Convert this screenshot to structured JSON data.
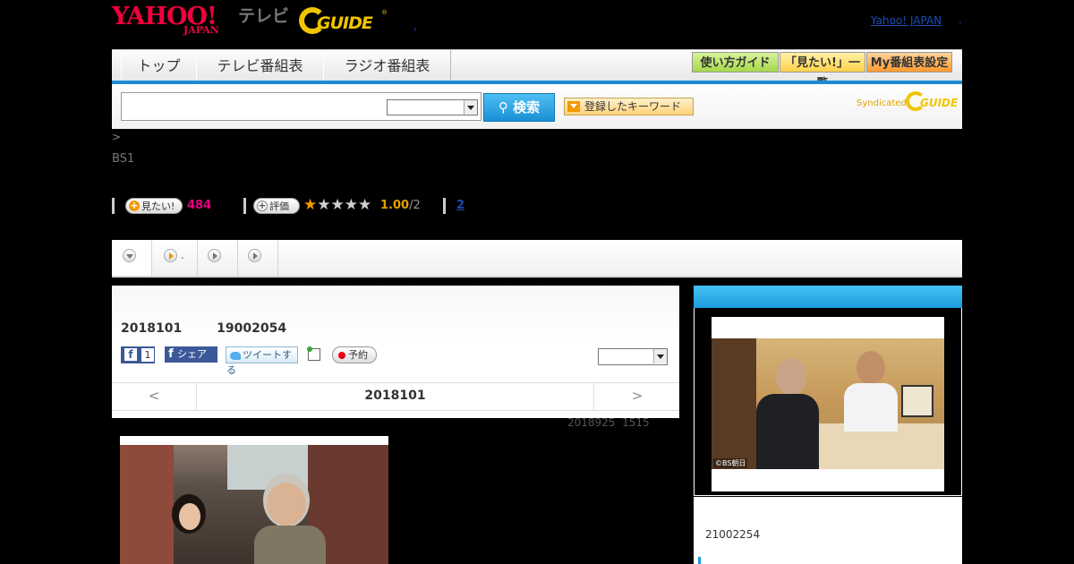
{
  "header": {
    "yahoo_logo": "YAHOO!",
    "yahoo_logo_sub": "JAPAN",
    "tv_label": "テレビ",
    "gguide_logo": "GUIDE",
    "gguide_mark": "®",
    "yahoo_japan_link": "Yahoo! JAPAN",
    "yahoo_japan_link_dot": "."
  },
  "nav": {
    "tabs": [
      {
        "label": "トップ"
      },
      {
        "label": "テレビ番組表"
      },
      {
        "label": "ラジオ番組表"
      }
    ],
    "right_buttons": [
      {
        "label": "使い方ガイド",
        "color": "#a6d84b"
      },
      {
        "label": "「見たい!」一覧",
        "color": "#ffd24a"
      },
      {
        "label": "My番組表設定",
        "color": "#ff9a2e"
      }
    ],
    "accent_color": "#1e88d8"
  },
  "search": {
    "input_value": "",
    "select_value": "",
    "button_label": "検索",
    "keyword_button_label": "登録したキーワード",
    "syndicated_label": "Syndicated",
    "syndicated_logo": "GUIDE"
  },
  "breadcrumb": ">",
  "channel": "BS1",
  "stats": {
    "want_label": "見たい!",
    "want_count": "484",
    "rate_label": "評価",
    "rating_stars": 1,
    "rating_value": "1.00",
    "rating_count": "/2",
    "link_label": "2"
  },
  "tabs": {
    "tab2_label": "."
  },
  "program": {
    "title_line": "2018101        19002054",
    "fb_count": "1",
    "fb_share_label": "シェア",
    "tweet_label": "ツイートする",
    "reserve_label": "予約",
    "date_nav": {
      "prev": "<",
      "current": "2018101",
      "next": ">"
    },
    "updated_line": "2018925  1515"
  },
  "sidebar": {
    "photo_credit": "©BS朝日",
    "time_line": "21002254"
  }
}
